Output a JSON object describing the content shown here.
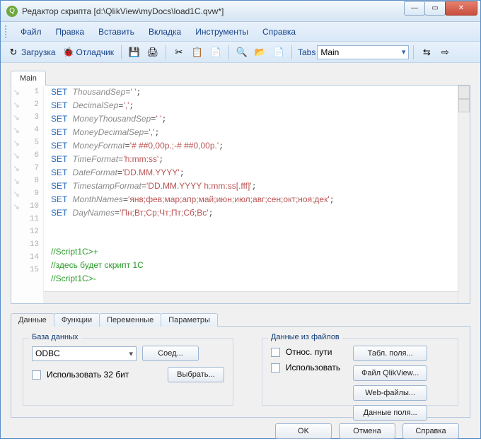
{
  "window": {
    "title": "Редактор скрипта [d:\\QlikView\\myDocs\\load1C.qvw*]"
  },
  "menu": {
    "file": "Файл",
    "edit": "Правка",
    "insert": "Вставить",
    "tab": "Вкладка",
    "tools": "Инструменты",
    "help": "Справка"
  },
  "toolbar": {
    "load": "Загрузка",
    "debugger": "Отладчик",
    "tabs_label": "Tabs",
    "tabs_value": "Main"
  },
  "editor": {
    "tab": "Main",
    "lines": [
      {
        "n": "1",
        "kw": "SET",
        "var": "ThousandSep",
        "str": "' '",
        "suffix": ";"
      },
      {
        "n": "2",
        "kw": "SET",
        "var": "DecimalSep",
        "str": "','",
        "suffix": ";"
      },
      {
        "n": "3",
        "kw": "SET",
        "var": "MoneyThousandSep",
        "str": "' '",
        "suffix": ";"
      },
      {
        "n": "4",
        "kw": "SET",
        "var": "MoneyDecimalSep",
        "str": "','",
        "suffix": ";"
      },
      {
        "n": "5",
        "kw": "SET",
        "var": "MoneyFormat",
        "str": "'# ##0,00р.;-# ##0,00р.'",
        "suffix": ";"
      },
      {
        "n": "6",
        "kw": "SET",
        "var": "TimeFormat",
        "str": "'h:mm:ss'",
        "suffix": ";"
      },
      {
        "n": "7",
        "kw": "SET",
        "var": "DateFormat",
        "str": "'DD.MM.YYYY'",
        "suffix": ";"
      },
      {
        "n": "8",
        "kw": "SET",
        "var": "TimestampFormat",
        "str": "'DD.MM.YYYY h:mm:ss[.fff]'",
        "suffix": ";"
      },
      {
        "n": "9",
        "kw": "SET",
        "var": "MonthNames",
        "str": "'янв;фев;мар;апр;май;июн;июл;авг;сен;окт;ноя;дек'",
        "suffix": ";"
      },
      {
        "n": "10",
        "kw": "SET",
        "var": "DayNames",
        "str": "'Пн;Вт;Ср;Чт;Пт;Сб;Вс'",
        "suffix": ";"
      },
      {
        "n": "11",
        "blank": ""
      },
      {
        "n": "12",
        "blank": ""
      },
      {
        "n": "13",
        "cmt": "//Script1C>+"
      },
      {
        "n": "14",
        "cmt": "//здесь будет скрипт 1С"
      },
      {
        "n": "15",
        "cmt": "//Script1C>-"
      }
    ]
  },
  "panel": {
    "tabs": {
      "data": "Данные",
      "functions": "Функции",
      "variables": "Переменные",
      "parameters": "Параметры"
    },
    "db": {
      "legend": "База данных",
      "source": "ODBC",
      "connect": "Соед...",
      "use32": "Использовать 32 бит",
      "select": "Выбрать..."
    },
    "files": {
      "legend": "Данные из файлов",
      "relpath": "Относ. пути",
      "use": "Использовать",
      "tablefields": "Табл. поля...",
      "qlikfile": "Файл QlikView...",
      "webfiles": "Web-файлы...",
      "datafields": "Данные поля..."
    }
  },
  "dialog": {
    "ok": "OK",
    "cancel": "Отмена",
    "help": "Справка"
  }
}
